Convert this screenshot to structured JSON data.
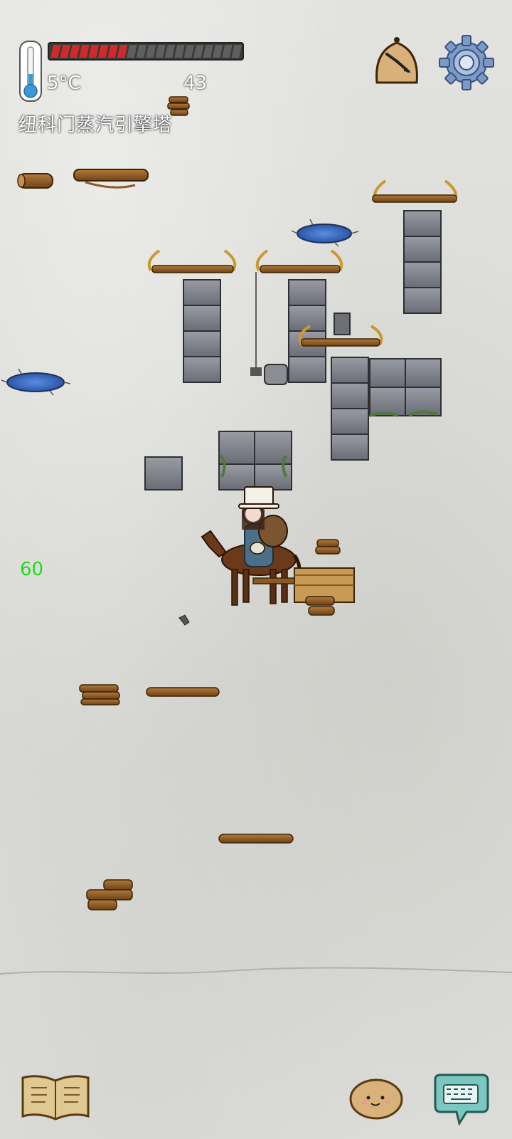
{
  "hud": {
    "temperature": "5°C",
    "wood_count": "43",
    "location": "纽科门蒸汽引擎塔",
    "health_fraction": 0.4,
    "fps": "60"
  },
  "icons": {
    "thermometer": "thermometer-icon",
    "health": "health-bar",
    "firewood": "firewood-icon",
    "time": "pocket-watch-icon",
    "settings": "gear-icon",
    "journal": "book-icon",
    "companion": "potato-icon",
    "chat": "keyboard-chat-icon"
  },
  "colors": {
    "health_fill": "#d22a2a",
    "health_empty": "#5f5f5f",
    "fps_text": "#1edc1e",
    "water": "#3b6fc6",
    "stone": "#7b7e86",
    "wood": "#8a5a22"
  }
}
